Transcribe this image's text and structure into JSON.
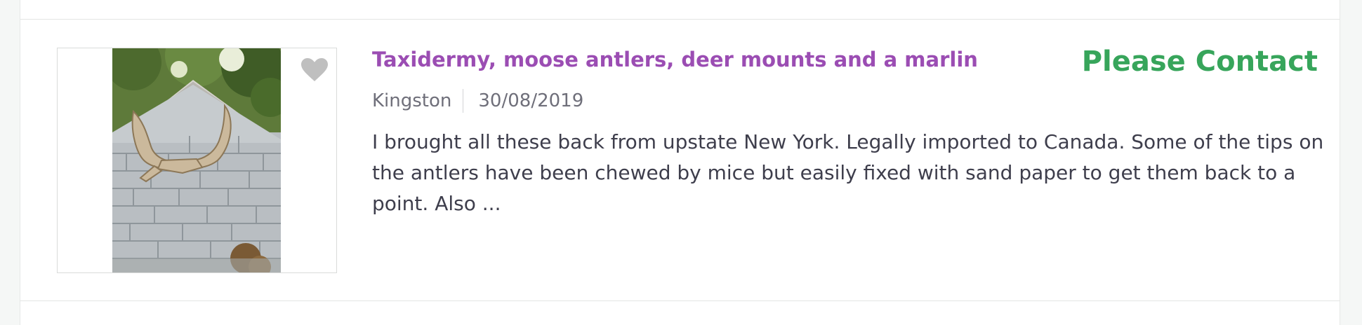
{
  "listing": {
    "title": "Taxidermy, moose antlers, deer mounts and a marlin",
    "price": "Please Contact",
    "location": "Kingston",
    "date": "30/08/2019",
    "description": "I brought all these back from upstate New York. Legally imported to Canada. Some of the tips on the antlers have been chewed by mice but easily fixed with sand paper to get them back to a point. Also ...",
    "favorite_icon": "heart-icon",
    "colors": {
      "title": "#9b4db3",
      "price": "#37a55b",
      "text": "#3e3e4c",
      "meta": "#6f6f7a"
    }
  }
}
